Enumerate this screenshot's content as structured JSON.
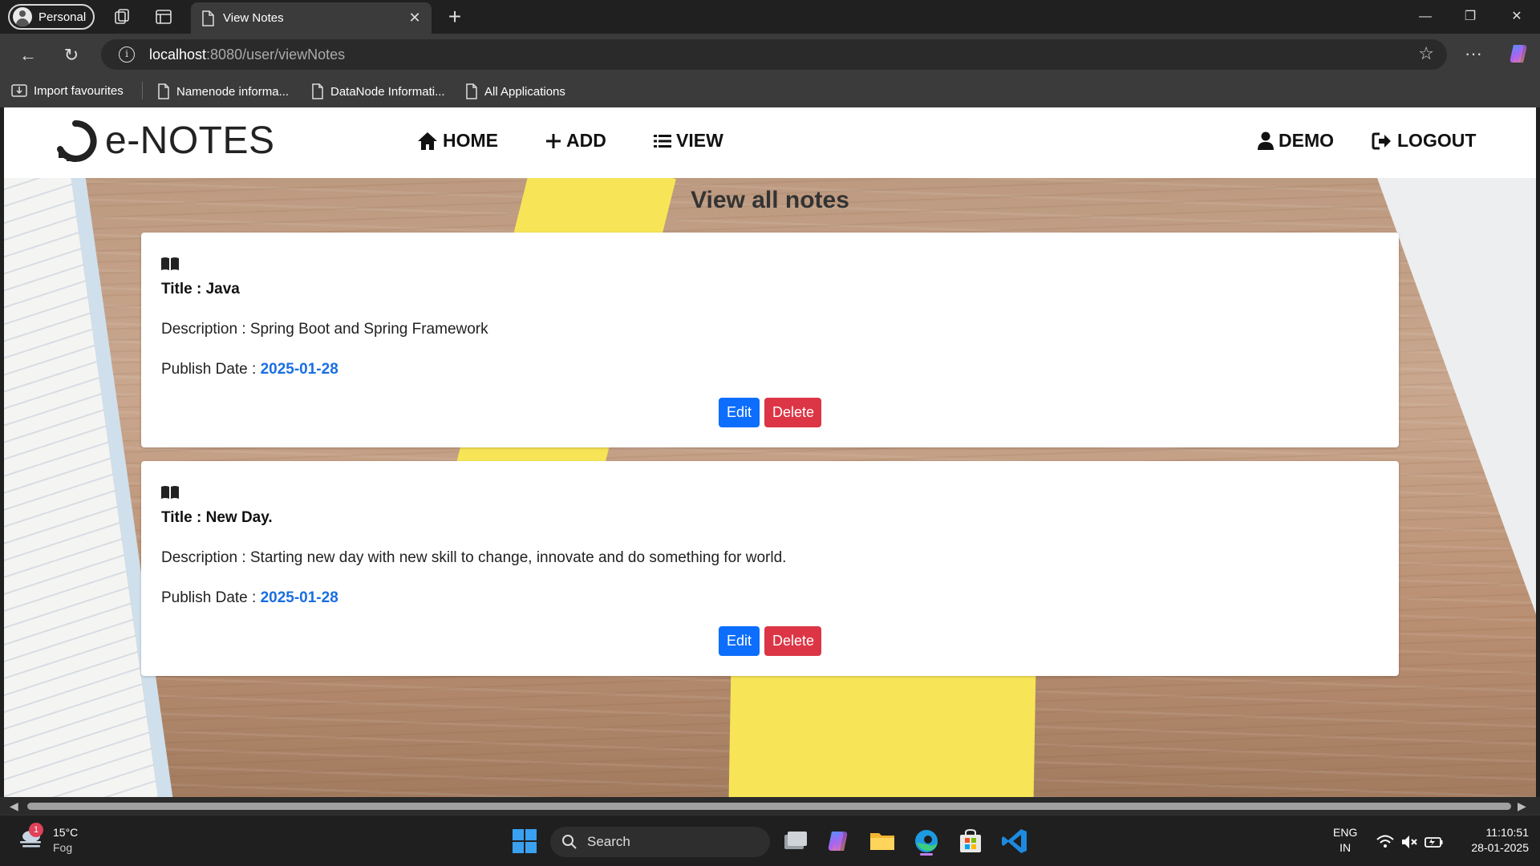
{
  "browser": {
    "profile_label": "Personal",
    "tab_title": "View Notes",
    "url_host": "localhost",
    "url_path": ":8080/user/viewNotes",
    "bookmarks": [
      "Import favourites",
      "Namenode informa...",
      "DataNode Informati...",
      "All Applications"
    ]
  },
  "app": {
    "brand": "e-NOTES",
    "nav": {
      "home": "HOME",
      "add": "ADD",
      "view": "VIEW",
      "user": "DEMO",
      "logout": "LOGOUT"
    },
    "page_title": "View all notes",
    "notes": [
      {
        "title": "Title : Java",
        "description": "Description : Spring Boot and Spring Framework",
        "date_label": "Publish Date : ",
        "date": "2025-01-28",
        "edit_label": "Edit",
        "delete_label": "Delete"
      },
      {
        "title": "Title : New Day.",
        "description": "Description : Starting new day with new skill to change, innovate and do something for world.",
        "date_label": "Publish Date : ",
        "date": "2025-01-28",
        "edit_label": "Edit",
        "delete_label": "Delete"
      }
    ],
    "colors": {
      "primary": "#0d6efd",
      "danger": "#dc3545",
      "date": "#1a6fe0"
    }
  },
  "taskbar": {
    "weather_temp": "15°C",
    "weather_desc": "Fog",
    "weather_badge": "1",
    "search_placeholder": "Search",
    "lang_top": "ENG",
    "lang_bottom": "IN",
    "time": "11:10:51",
    "date": "28-01-2025"
  }
}
